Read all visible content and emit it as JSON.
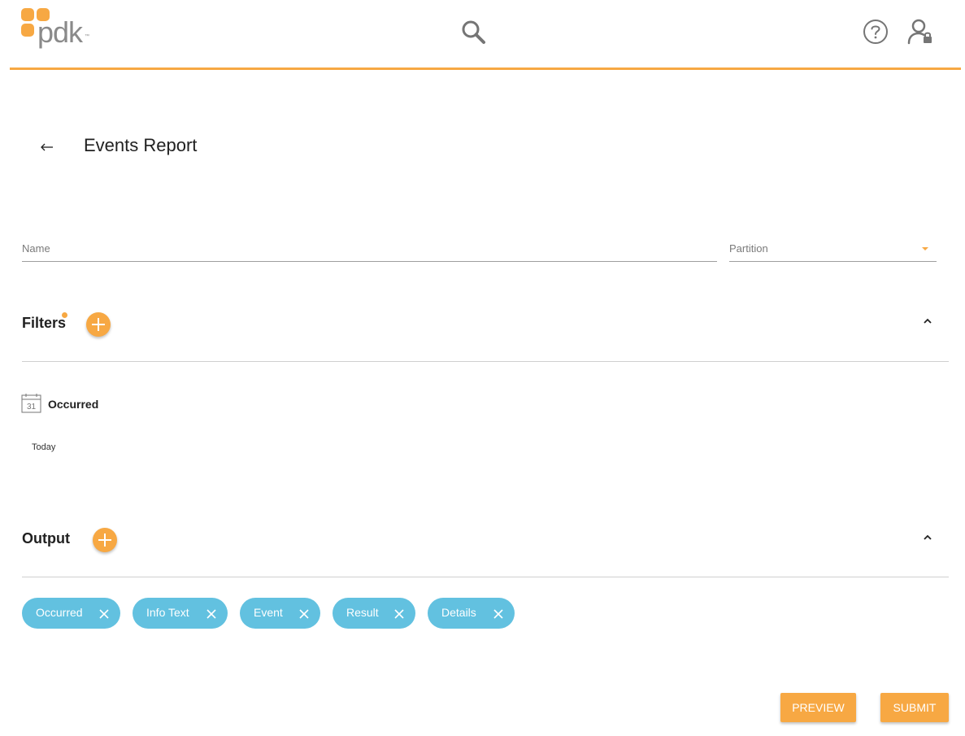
{
  "header": {
    "logo_text": "pdk",
    "logo_tm": "™",
    "logo_color": "#f7a843",
    "accent_color": "#f7a843"
  },
  "page": {
    "title": "Events Report"
  },
  "form": {
    "name_placeholder": "Name",
    "partition_placeholder": "Partition"
  },
  "filters": {
    "title": "Filters",
    "items": [
      {
        "icon": "calendar-icon",
        "icon_text": "31",
        "label": "Occurred",
        "value": "Today"
      }
    ]
  },
  "output": {
    "title": "Output",
    "chip_color": "#62c1e0",
    "chips": [
      {
        "label": "Occurred"
      },
      {
        "label": "Info Text"
      },
      {
        "label": "Event"
      },
      {
        "label": "Result"
      },
      {
        "label": "Details"
      }
    ]
  },
  "actions": {
    "preview_label": "PREVIEW",
    "submit_label": "SUBMIT"
  }
}
